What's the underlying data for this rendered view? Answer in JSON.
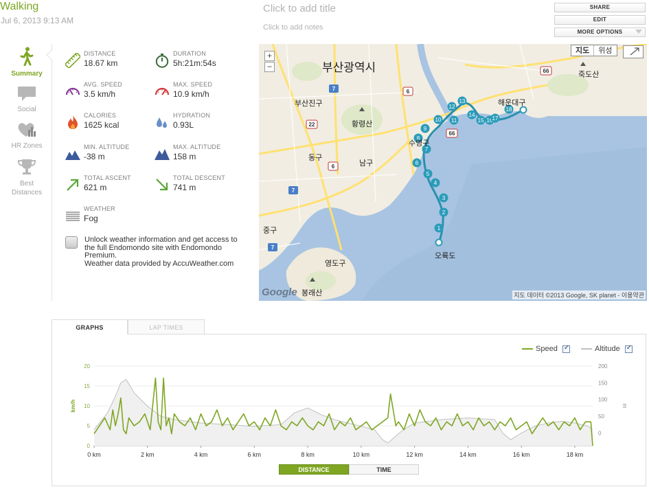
{
  "header": {
    "activity": "Walking",
    "date": "Jul 6, 2013 9:13 AM",
    "title_placeholder": "Click to add title",
    "notes_placeholder": "Click to add notes",
    "buttons": {
      "share": "SHARE",
      "edit": "EDIT",
      "more": "MORE OPTIONS"
    }
  },
  "nav": {
    "summary": "Summary",
    "social": "Social",
    "hr_zones": "HR Zones",
    "best_distances": "Best Distances"
  },
  "stats": {
    "distance": {
      "label": "DISTANCE",
      "value": "18.67 km"
    },
    "duration": {
      "label": "DURATION",
      "value": "5h:21m:54s"
    },
    "avg_speed": {
      "label": "AVG. SPEED",
      "value": "3.5 km/h"
    },
    "max_speed": {
      "label": "MAX. SPEED",
      "value": "10.9 km/h"
    },
    "calories": {
      "label": "CALORIES",
      "value": "1625 kcal"
    },
    "hydration": {
      "label": "HYDRATION",
      "value": "0.93L"
    },
    "min_altitude": {
      "label": "MIN. ALTITUDE",
      "value": "-38 m"
    },
    "max_altitude": {
      "label": "MAX. ALTITUDE",
      "value": "158 m"
    },
    "total_ascent": {
      "label": "TOTAL ASCENT",
      "value": "621 m"
    },
    "total_descent": {
      "label": "TOTAL DESCENT",
      "value": "741 m"
    },
    "weather": {
      "label": "WEATHER",
      "value": "Fog"
    }
  },
  "unlock": {
    "line1": "Unlock weather information and get access to the full Endomondo site with Endomondo Premium.",
    "line2": "Weather data provided by AccuWeather.com"
  },
  "map": {
    "zoom_in": "+",
    "zoom_out": "−",
    "type_map": "지도",
    "type_satellite": "위성",
    "copyright": "지도 데이터 ©2013 Google, SK planet - 이용약관",
    "logo": "Google",
    "labels": {
      "busan": "부산광역시",
      "busanjin": "부산진구",
      "hwangryeong": "황령산",
      "dong": "동구",
      "nam": "남구",
      "suyeong": "수영구",
      "haeundae": "해운대구",
      "jung": "중구",
      "yeongdo": "영도구",
      "bongnae": "봉래산",
      "oryukdo": "오륙도",
      "dongbaek": "죽도산"
    },
    "road_badges": [
      "7",
      "6",
      "22",
      "6",
      "7",
      "66",
      "66",
      "7"
    ],
    "markers": [
      "1",
      "2",
      "3",
      "4",
      "5",
      "6",
      "7",
      "8",
      "9",
      "10",
      "11",
      "12",
      "13",
      "14",
      "15",
      "16",
      "17",
      "18"
    ]
  },
  "graph": {
    "tabs": {
      "graphs": "GRAPHS",
      "laps": "LAP TIMES"
    },
    "legend": {
      "speed": "Speed",
      "altitude": "Altitude"
    },
    "toggles": {
      "distance": "DISTANCE",
      "time": "TIME"
    },
    "colors": {
      "speed": "#7ea622",
      "altitude": "#c0c0c0"
    }
  },
  "chart_data": {
    "type": "line",
    "xlabel": "",
    "ylabel": "km/h",
    "ylabel_right": "m",
    "x_ticks": [
      "0 km",
      "2 km",
      "4 km",
      "6 km",
      "8 km",
      "10 km",
      "12 km",
      "14 km",
      "16 km",
      "18 km"
    ],
    "y_ticks_left": [
      "0",
      "5",
      "10",
      "15",
      "20"
    ],
    "y_ticks_right": [
      "0",
      "50",
      "100",
      "150",
      "200"
    ],
    "xlim": [
      0,
      18.67
    ],
    "ylim": [
      0,
      20
    ],
    "ylim_right": [
      -38,
      200
    ],
    "series": [
      {
        "name": "Speed",
        "axis": "left",
        "x": [
          0,
          0.2,
          0.4,
          0.6,
          0.7,
          0.8,
          0.9,
          1.0,
          1.1,
          1.2,
          1.3,
          1.5,
          1.7,
          1.9,
          2.1,
          2.3,
          2.4,
          2.5,
          2.6,
          2.7,
          2.8,
          2.9,
          3.0,
          3.2,
          3.4,
          3.6,
          3.8,
          4.0,
          4.2,
          4.4,
          4.6,
          4.8,
          5.0,
          5.2,
          5.4,
          5.6,
          5.8,
          6.0,
          6.2,
          6.4,
          6.6,
          6.8,
          7.0,
          7.2,
          7.4,
          7.6,
          7.8,
          8.0,
          8.2,
          8.4,
          8.6,
          8.8,
          9.0,
          9.2,
          9.4,
          9.6,
          9.8,
          10.0,
          10.2,
          10.4,
          10.6,
          10.8,
          11.0,
          11.1,
          11.2,
          11.3,
          11.4,
          11.6,
          11.8,
          12.0,
          12.2,
          12.4,
          12.6,
          12.8,
          13.0,
          13.2,
          13.4,
          13.6,
          13.8,
          14.0,
          14.2,
          14.4,
          14.6,
          14.8,
          15.0,
          15.2,
          15.4,
          15.6,
          15.8,
          16.0,
          16.2,
          16.4,
          16.6,
          16.8,
          17.0,
          17.2,
          17.4,
          17.6,
          17.8,
          18.0,
          18.2,
          18.4,
          18.6,
          18.67
        ],
        "values": [
          3,
          5,
          7,
          4,
          9,
          5,
          8,
          12,
          4,
          3,
          7,
          5,
          6,
          8,
          4,
          17,
          6,
          4,
          17,
          5,
          7,
          3,
          8,
          6,
          5,
          7,
          4,
          8,
          5,
          6,
          9,
          5,
          7,
          4,
          6,
          8,
          5,
          6,
          4,
          7,
          5,
          9,
          5,
          4,
          6,
          5,
          7,
          5,
          4,
          6,
          5,
          8,
          4,
          6,
          5,
          7,
          4,
          5,
          6,
          4,
          5,
          6,
          7,
          13,
          9,
          5,
          6,
          4,
          8,
          5,
          9,
          6,
          5,
          7,
          4,
          6,
          5,
          8,
          5,
          6,
          4,
          7,
          5,
          6,
          4,
          6,
          5,
          7,
          4,
          5,
          6,
          3,
          5,
          7,
          5,
          6,
          4,
          6,
          5,
          7,
          4,
          6,
          6,
          0
        ]
      },
      {
        "name": "Altitude",
        "axis": "right",
        "x": [
          0,
          0.5,
          0.8,
          1.0,
          1.2,
          1.5,
          2.0,
          2.5,
          3.0,
          3.5,
          4.0,
          5.0,
          6.0,
          7.0,
          7.5,
          8.0,
          8.5,
          9.0,
          9.5,
          10.0,
          10.5,
          10.8,
          11.0,
          11.5,
          12.0,
          13.0,
          14.0,
          15.0,
          15.3,
          15.6,
          16.0,
          16.5,
          17.0,
          17.5,
          18.0,
          18.5,
          18.67
        ],
        "values": [
          10,
          60,
          110,
          150,
          160,
          120,
          80,
          50,
          40,
          35,
          30,
          25,
          20,
          25,
          60,
          75,
          55,
          40,
          30,
          20,
          10,
          -20,
          -30,
          5,
          30,
          40,
          45,
          40,
          0,
          -20,
          0,
          20,
          30,
          35,
          30,
          20,
          10
        ]
      }
    ]
  }
}
